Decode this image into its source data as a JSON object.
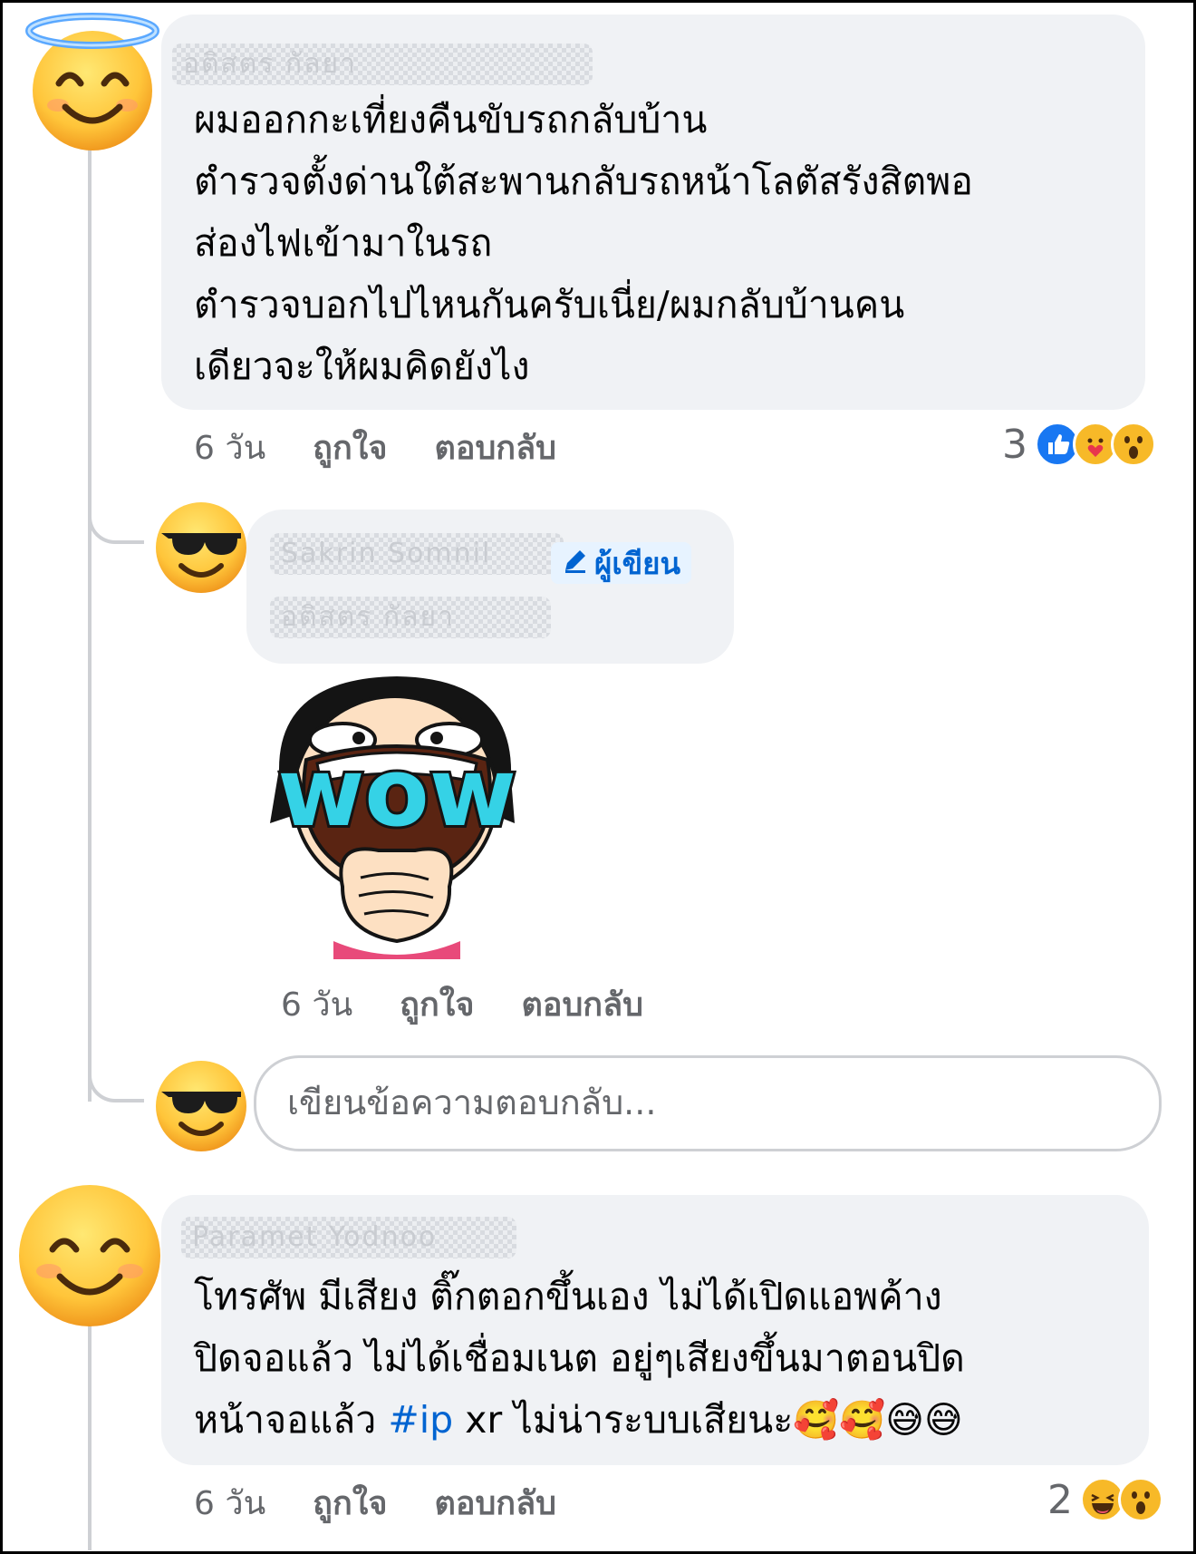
{
  "comments": [
    {
      "author": "อติสตร กัลยา",
      "author_style": "blurred",
      "text": "ผมออกกะเที่ยงคืนขับรถกลับบ้าน\nตำรวจตั้งด่านใต้สะพานกลับรถหน้าโลตัสรังสิตพอ\nส่องไฟเข้ามาในรถ\nตำรวจบอกไปไหนกันครับเนี่ย/ผมกลับบ้านคน\nเดียวจะให้ผมคิดยังไง",
      "time": "6 วัน",
      "like_label": "ถูกใจ",
      "reply_label": "ตอบกลับ",
      "reaction_count": "3",
      "reactions": [
        "like-icon",
        "care-icon",
        "wow-icon"
      ],
      "avatar_icon": "smiling-face-with-halo-icon"
    },
    {
      "author": "Sakrin Somnil",
      "author_style": "blurred",
      "author_badge": "ผู้เขียน",
      "mention": "อติสตร กัลยา",
      "sticker": "wow-sticker",
      "sticker_text": "wow",
      "time": "6 วัน",
      "like_label": "ถูกใจ",
      "reply_label": "ตอบกลับ",
      "avatar_icon": "smiling-face-with-sunglasses-icon"
    },
    {
      "author": "Paramet Yodnoo",
      "author_style": "blurred",
      "text_before": "โทรศัพ มีเสียง ติ๊กตอกขึ้นเอง ไม่ได้เปิดแอพค้าง\nปิดจอแล้ว ไม่ได้เชื่อมเนต อยู่ๆเสียงขึ้นมาตอนปิด\nหน้าจอแล้ว ",
      "hashtag": "#ip",
      "text_after": " xr ไม่น่าระบบเสียนะ🥰🥰😅😅",
      "time": "6 วัน",
      "like_label": "ถูกใจ",
      "reply_label": "ตอบกลับ",
      "reaction_count": "2",
      "reactions": [
        "haha-icon",
        "wow-icon"
      ],
      "avatar_icon": "smiling-face-icon"
    }
  ],
  "reply_box": {
    "placeholder": "เขียนข้อความตอบกลับ...",
    "avatar_icon": "smiling-face-with-sunglasses-icon"
  },
  "colors": {
    "bubble": "#f0f2f5",
    "link": "#0064d1",
    "meta": "#65676b",
    "thread_line": "#ced0d4"
  }
}
